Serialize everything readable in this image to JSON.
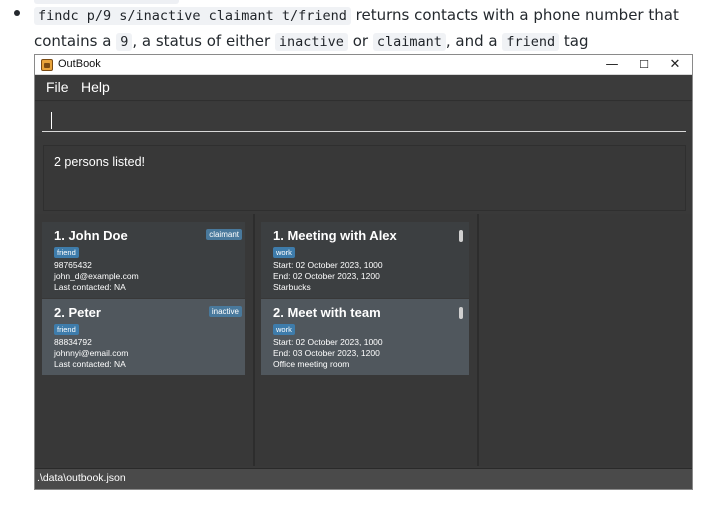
{
  "doc": {
    "line1": {
      "code": "findc p/9 s/inactive claimant t/friend",
      "text": " returns contacts with a phone number that"
    },
    "line2": {
      "pre": "contains a ",
      "code1": "9",
      "mid1": ", a status of either ",
      "code2": "inactive",
      "mid2": " or ",
      "code3": "claimant",
      "mid3": ", and a ",
      "code4": "friend",
      "post": " tag"
    }
  },
  "window": {
    "title": "OutBook",
    "controls": {
      "minimize": "—",
      "maximize": "☐",
      "close": "✕"
    }
  },
  "menu": {
    "file": "File",
    "help": "Help"
  },
  "command": {
    "value": "",
    "placeholder": ""
  },
  "result": {
    "text": "2 persons listed!"
  },
  "persons": [
    {
      "title": "1.  John Doe",
      "status": "claimant",
      "tag": "friend",
      "phone": "98765432",
      "email": "john_d@example.com",
      "last_contacted": "Last contacted: NA"
    },
    {
      "title": "2.  Peter",
      "status": "inactive",
      "tag": "friend",
      "phone": "88834792",
      "email": "johnnyi@email.com",
      "last_contacted": "Last contacted: NA"
    }
  ],
  "meetings": [
    {
      "title": "1.  Meeting with Alex",
      "tag": "work",
      "start": "Start: 02 October 2023, 1000",
      "end": "End: 02 October 2023, 1200",
      "location": "Starbucks"
    },
    {
      "title": "2.  Meet with team",
      "tag": "work",
      "start": "Start: 02 October 2023, 1000",
      "end": "End: 03 October 2023, 1200",
      "location": "Office meeting room"
    }
  ],
  "status_bar": {
    "path": ".\\data\\outbook.json"
  },
  "colors": {
    "window_bg": "#393939",
    "card_bg": "#3c3f41",
    "card_selected_bg": "#50575d",
    "tag_badge": "#3e7cab",
    "status_badge": "#49799c"
  }
}
